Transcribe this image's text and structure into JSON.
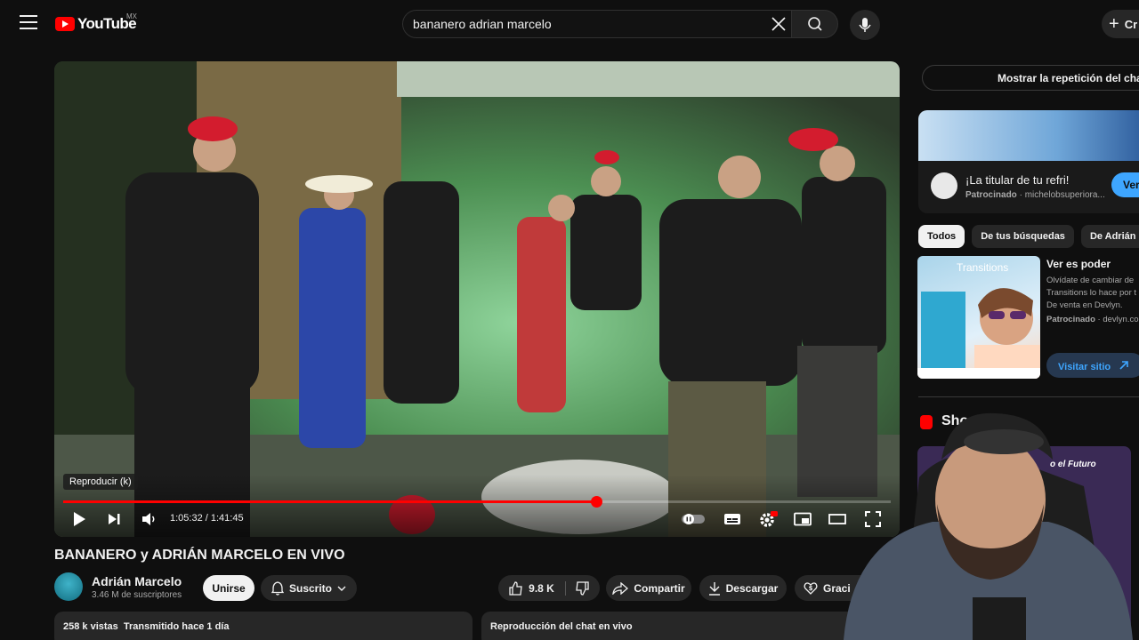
{
  "header": {
    "logo_text": "YouTube",
    "region": "MX",
    "search_value": "bananero adrian marcelo",
    "create_label": "Cr"
  },
  "player": {
    "tooltip": "Reproducir (k)",
    "current_time": "1:05:32",
    "duration": "1:41:45",
    "time_display": "1:05:32 / 1:41:45",
    "progress_fraction": 0.644
  },
  "video": {
    "title": "BANANERO y ADRIÁN MARCELO EN VIVO",
    "channel_name": "Adrián Marcelo",
    "subscribers": "3.46 M de suscriptores",
    "join_label": "Unirse",
    "subscribed_label": "Suscrito",
    "likes": "9.8 K",
    "share_label": "Compartir",
    "download_label": "Descargar",
    "thanks_label": "Graci",
    "views_line": "258 k vistas  Transmitido hace 1 día",
    "chat_replay_label": "Reproducción del chat en vivo"
  },
  "sidebar": {
    "show_chat_label": "Mostrar la repetición del chat",
    "ad1": {
      "title": "¡La titular de tu refri!",
      "sponsor_prefix": "Patrocinado",
      "sponsor_domain": "michelobsuperiora...",
      "button_label": "Ver"
    },
    "chips": [
      "Todos",
      "De tus búsquedas",
      "De Adrián M"
    ],
    "ad2": {
      "title": "Ver es poder",
      "text": "Olvídate de cambiar de Transitions lo hace por t De venta en Devlyn.",
      "sponsor_prefix": "Patrocinado",
      "sponsor_domain": "devlyn.co",
      "button_label": "Visitar sitio",
      "brand_text": "Transitions"
    },
    "shorts_title": "Shorts",
    "short_text": "o el Futuro"
  },
  "colors": {
    "accent_red": "#ff0000",
    "link_blue": "#3ea6ff",
    "background": "#0f0f0f"
  }
}
